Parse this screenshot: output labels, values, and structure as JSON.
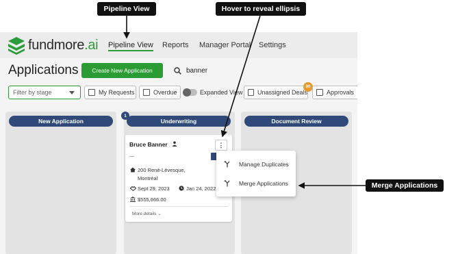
{
  "annotations": {
    "pipeline_view": "Pipeline View",
    "hover_ellipsis": "Hover to reveal ellipsis",
    "merge_applications": "Merge Applications"
  },
  "app": {
    "logo_main": "fundmore",
    "logo_suffix": ".ai",
    "brand_color": "#2a9d3a",
    "nav": [
      {
        "label": "Pipeline View",
        "active": true
      },
      {
        "label": "Reports",
        "active": false
      },
      {
        "label": "Manager Portal",
        "active": false
      },
      {
        "label": "Settings",
        "active": false
      }
    ]
  },
  "toolbar": {
    "title": "Applications",
    "create_button": "Create New Application",
    "search_value": "banner"
  },
  "filters": {
    "stage_placeholder": "Filter by stage",
    "my_requests": "My Requests",
    "overdue": "Overdue",
    "expanded_view": "Expanded View",
    "unassigned_deals": "Unassigned Deals",
    "unassigned_count": "80",
    "approvals": "Approvals"
  },
  "columns": [
    {
      "title": "New Application"
    },
    {
      "title": "Underwriting",
      "count": "1"
    },
    {
      "title": "Document Review"
    }
  ],
  "card": {
    "name": "Bruce Banner",
    "dash": "—",
    "address_line1": "200 René-Lévesque,",
    "address_line2": "Montréal",
    "date1": "Sept 29, 2023",
    "date2": "Jan 24, 2022",
    "amount": "$555,666.00",
    "more": "More details"
  },
  "menu": {
    "items": [
      {
        "label": "Manage Duplicates",
        "icon": "merge-icon"
      },
      {
        "label": "Merge Applications",
        "icon": "merge-icon"
      }
    ]
  },
  "colors": {
    "accent": "#2a9d3a",
    "column_header": "#2f4a78",
    "badge": "#e89a2c"
  }
}
